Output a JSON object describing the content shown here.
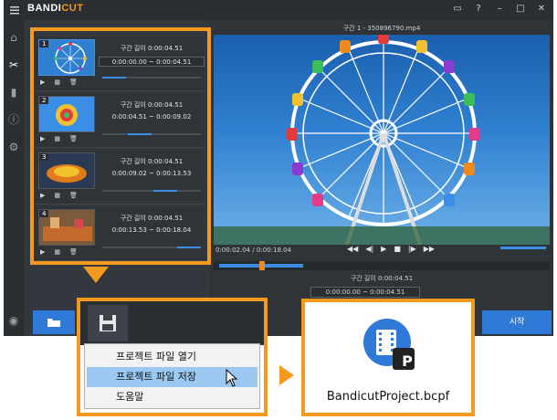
{
  "app": {
    "title_prefix": "BANDI",
    "title_suffix": "CUT",
    "titlebar_icons": [
      "folder-icon",
      "help-icon",
      "minimize-icon",
      "maximize-icon",
      "close-icon"
    ]
  },
  "segments_panel": {
    "segments": [
      {
        "number": "1",
        "length_label": "구간 길이 0:00:04.51",
        "range": "0:00:00.00 ~ 0:00:04.51",
        "selected": true
      },
      {
        "number": "2",
        "length_label": "구간 길이 0:00:04.51",
        "range": "0:00:04.51 ~ 0:00:09.02",
        "selected": false
      },
      {
        "number": "3",
        "length_label": "구간 길이 0:00:04.51",
        "range": "0:00:09.02 ~ 0:00:13.53",
        "selected": false
      },
      {
        "number": "4",
        "length_label": "구간 길이 0:00:04.51",
        "range": "0:00:13.53 ~ 0:00:18.04",
        "selected": false
      }
    ]
  },
  "preview": {
    "title": "구간 1 - 350896790.mp4",
    "time": "0:00:02.04 / 0:00:18.04",
    "segment_length": "구간 길이 0:00:04.51",
    "segment_range": "0:00:00.00 ~ 0:00:04.51",
    "start_button": "시작"
  },
  "context_menu": {
    "items": [
      {
        "label": "프로젝트 파일 열기",
        "highlighted": false
      },
      {
        "label": "프로젝트 파일 저장",
        "highlighted": true
      },
      {
        "label": "도움말",
        "highlighted": false
      }
    ]
  },
  "file_callout": {
    "filename": "BandicutProject.bcpf",
    "badge": "P"
  },
  "colors": {
    "accent": "#f39a1e",
    "blue": "#2f7ad8",
    "dark": "#2b2f34"
  }
}
